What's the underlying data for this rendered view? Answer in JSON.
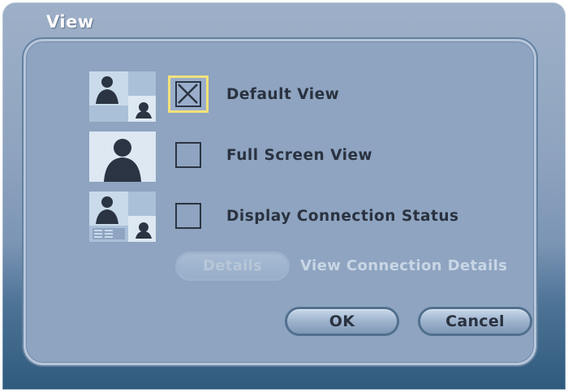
{
  "window": {
    "title": "View"
  },
  "options": [
    {
      "label": "Default View",
      "checked": true,
      "focused": true,
      "icon": "default-view-icon"
    },
    {
      "label": "Full Screen View",
      "checked": false,
      "focused": false,
      "icon": "full-screen-view-icon"
    },
    {
      "label": "Display Connection Status",
      "checked": false,
      "focused": false,
      "icon": "connection-status-view-icon"
    }
  ],
  "details": {
    "button_label": "Details",
    "enabled": false,
    "description": "View Connection Details"
  },
  "buttons": {
    "ok": "OK",
    "cancel": "Cancel"
  },
  "colors": {
    "frame_top": "#9eb0c8",
    "frame_bottom": "#2f5a7d",
    "panel": "#8ea4c0",
    "focus_ring": "#f3e27a",
    "text": "#2a3240",
    "disabled_text": "#c9d6e6"
  }
}
